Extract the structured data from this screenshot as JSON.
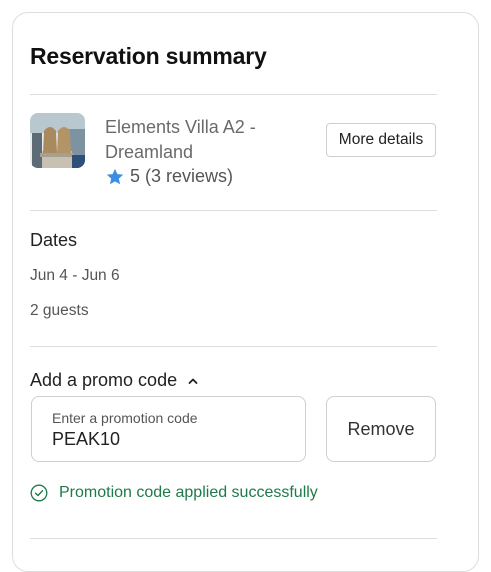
{
  "summary": {
    "title": "Reservation summary"
  },
  "property": {
    "name": "Elements Villa A2 - Dreamland",
    "rating": "5",
    "reviews": "(3 reviews)",
    "more_details_label": "More details",
    "thumbnail_icon": "villa-photo"
  },
  "dates": {
    "label": "Dates",
    "range": "Jun 4 - Jun 6",
    "guests": "2 guests"
  },
  "promo": {
    "toggle_label": "Add a promo code",
    "field_label": "Enter a promotion code",
    "value": "PEAK10",
    "remove_label": "Remove",
    "success_message": "Promotion code applied successfully"
  },
  "colors": {
    "star": "#3a8ee6",
    "success": "#1f7a4a",
    "border": "#dddddd"
  }
}
